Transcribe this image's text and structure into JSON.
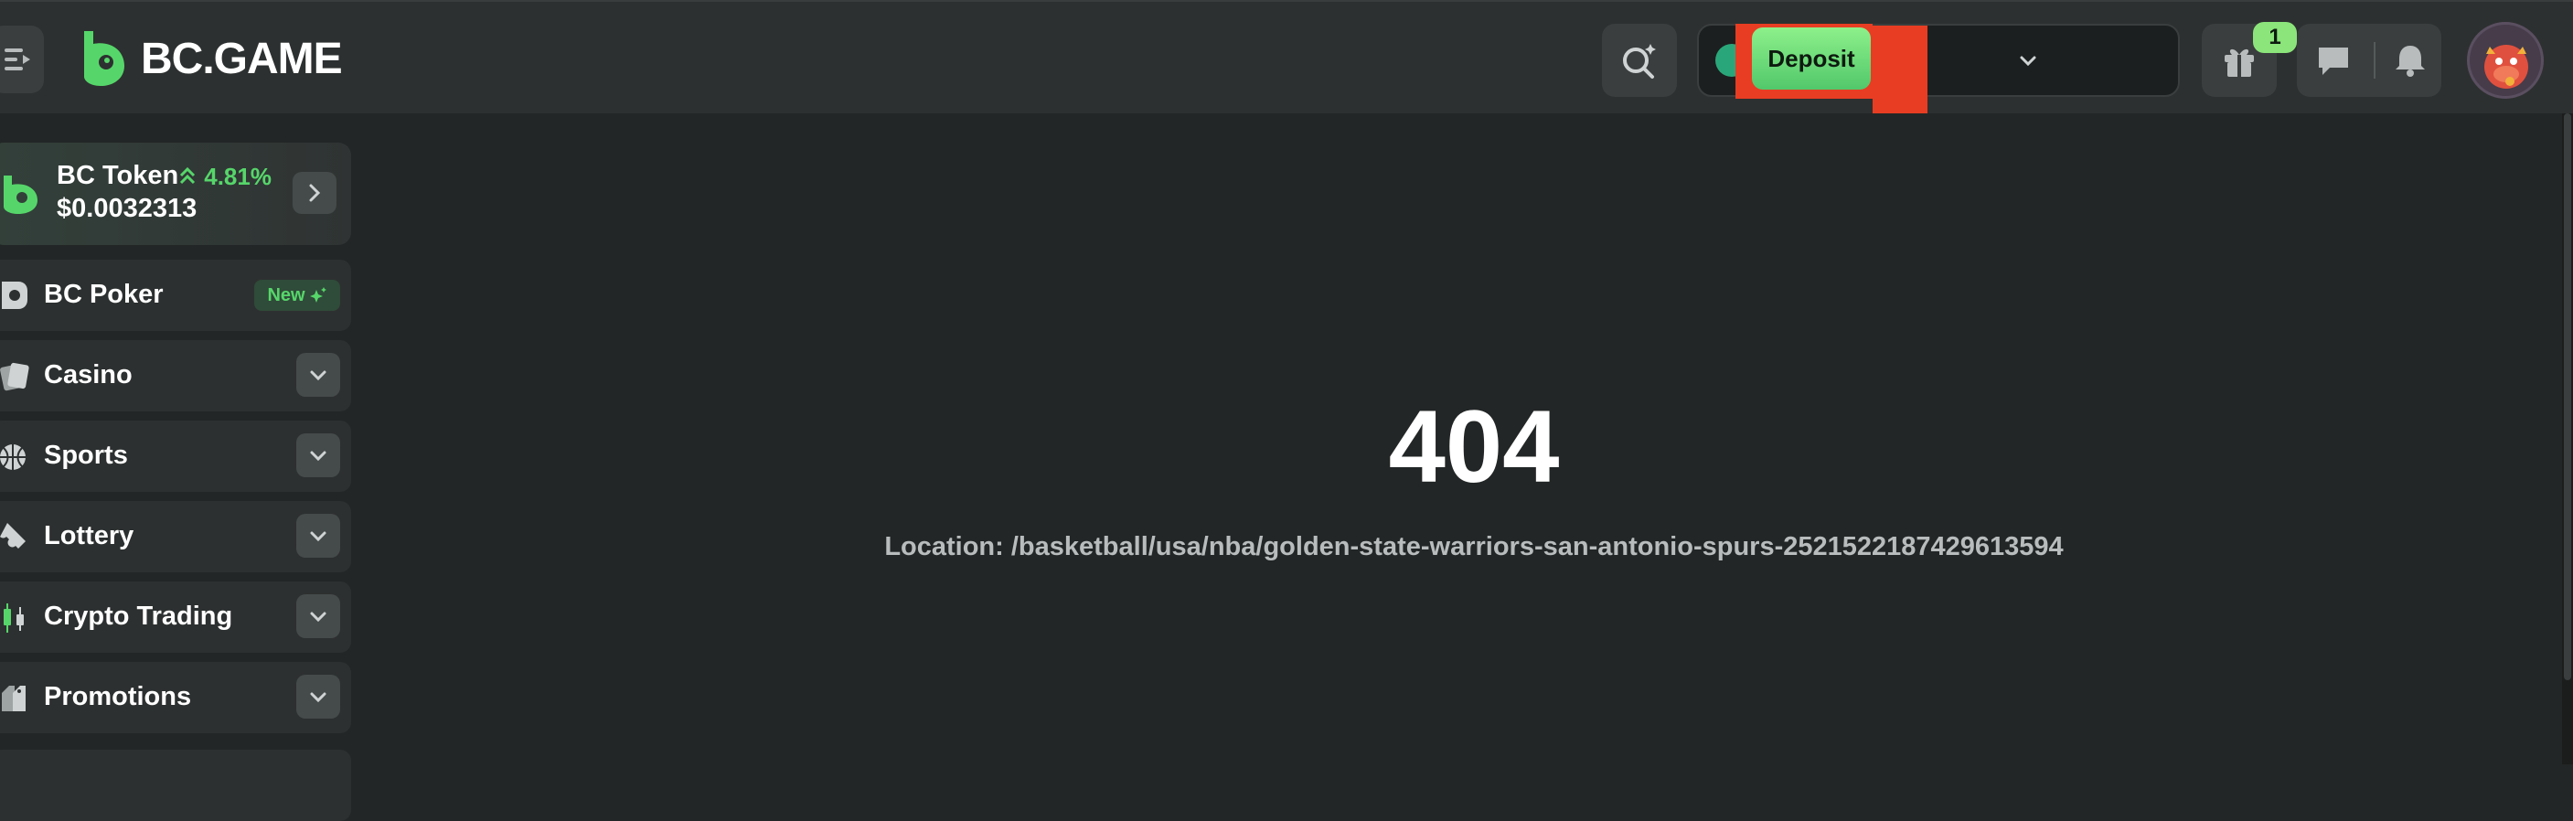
{
  "header": {
    "logo_text": "BC.GAME",
    "deposit_label": "Deposit",
    "gift_badge_count": "1"
  },
  "sidebar": {
    "token": {
      "name": "BC Token",
      "change": "4.81%",
      "price": "$0.0032313"
    },
    "items": [
      {
        "label": "BC Poker",
        "badge": "New",
        "icon": "poker-icon"
      },
      {
        "label": "Casino",
        "icon": "cards-icon"
      },
      {
        "label": "Sports",
        "icon": "basketball-icon"
      },
      {
        "label": "Lottery",
        "icon": "ticket-icon"
      },
      {
        "label": "Crypto Trading",
        "icon": "candlestick-icon"
      },
      {
        "label": "Promotions",
        "icon": "tag-icon"
      }
    ]
  },
  "main": {
    "error_code": "404",
    "location": "Location: /basketball/usa/nba/golden-state-warriors-san-antonio-spurs-2521522187429613594"
  },
  "colors": {
    "accent": "#56d66a",
    "background": "#232626",
    "panel": "#2d3030"
  }
}
